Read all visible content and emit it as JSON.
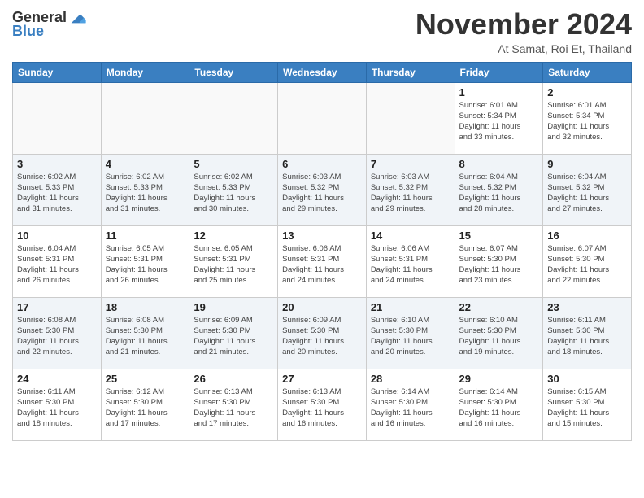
{
  "logo": {
    "general": "General",
    "blue": "Blue"
  },
  "title": "November 2024",
  "subtitle": "At Samat, Roi Et, Thailand",
  "days_of_week": [
    "Sunday",
    "Monday",
    "Tuesday",
    "Wednesday",
    "Thursday",
    "Friday",
    "Saturday"
  ],
  "weeks": [
    [
      {
        "day": "",
        "info": "",
        "empty": true
      },
      {
        "day": "",
        "info": "",
        "empty": true
      },
      {
        "day": "",
        "info": "",
        "empty": true
      },
      {
        "day": "",
        "info": "",
        "empty": true
      },
      {
        "day": "",
        "info": "",
        "empty": true
      },
      {
        "day": "1",
        "info": "Sunrise: 6:01 AM\nSunset: 5:34 PM\nDaylight: 11 hours\nand 33 minutes."
      },
      {
        "day": "2",
        "info": "Sunrise: 6:01 AM\nSunset: 5:34 PM\nDaylight: 11 hours\nand 32 minutes."
      }
    ],
    [
      {
        "day": "3",
        "info": "Sunrise: 6:02 AM\nSunset: 5:33 PM\nDaylight: 11 hours\nand 31 minutes."
      },
      {
        "day": "4",
        "info": "Sunrise: 6:02 AM\nSunset: 5:33 PM\nDaylight: 11 hours\nand 31 minutes."
      },
      {
        "day": "5",
        "info": "Sunrise: 6:02 AM\nSunset: 5:33 PM\nDaylight: 11 hours\nand 30 minutes."
      },
      {
        "day": "6",
        "info": "Sunrise: 6:03 AM\nSunset: 5:32 PM\nDaylight: 11 hours\nand 29 minutes."
      },
      {
        "day": "7",
        "info": "Sunrise: 6:03 AM\nSunset: 5:32 PM\nDaylight: 11 hours\nand 29 minutes."
      },
      {
        "day": "8",
        "info": "Sunrise: 6:04 AM\nSunset: 5:32 PM\nDaylight: 11 hours\nand 28 minutes."
      },
      {
        "day": "9",
        "info": "Sunrise: 6:04 AM\nSunset: 5:32 PM\nDaylight: 11 hours\nand 27 minutes."
      }
    ],
    [
      {
        "day": "10",
        "info": "Sunrise: 6:04 AM\nSunset: 5:31 PM\nDaylight: 11 hours\nand 26 minutes."
      },
      {
        "day": "11",
        "info": "Sunrise: 6:05 AM\nSunset: 5:31 PM\nDaylight: 11 hours\nand 26 minutes."
      },
      {
        "day": "12",
        "info": "Sunrise: 6:05 AM\nSunset: 5:31 PM\nDaylight: 11 hours\nand 25 minutes."
      },
      {
        "day": "13",
        "info": "Sunrise: 6:06 AM\nSunset: 5:31 PM\nDaylight: 11 hours\nand 24 minutes."
      },
      {
        "day": "14",
        "info": "Sunrise: 6:06 AM\nSunset: 5:31 PM\nDaylight: 11 hours\nand 24 minutes."
      },
      {
        "day": "15",
        "info": "Sunrise: 6:07 AM\nSunset: 5:30 PM\nDaylight: 11 hours\nand 23 minutes."
      },
      {
        "day": "16",
        "info": "Sunrise: 6:07 AM\nSunset: 5:30 PM\nDaylight: 11 hours\nand 22 minutes."
      }
    ],
    [
      {
        "day": "17",
        "info": "Sunrise: 6:08 AM\nSunset: 5:30 PM\nDaylight: 11 hours\nand 22 minutes."
      },
      {
        "day": "18",
        "info": "Sunrise: 6:08 AM\nSunset: 5:30 PM\nDaylight: 11 hours\nand 21 minutes."
      },
      {
        "day": "19",
        "info": "Sunrise: 6:09 AM\nSunset: 5:30 PM\nDaylight: 11 hours\nand 21 minutes."
      },
      {
        "day": "20",
        "info": "Sunrise: 6:09 AM\nSunset: 5:30 PM\nDaylight: 11 hours\nand 20 minutes."
      },
      {
        "day": "21",
        "info": "Sunrise: 6:10 AM\nSunset: 5:30 PM\nDaylight: 11 hours\nand 20 minutes."
      },
      {
        "day": "22",
        "info": "Sunrise: 6:10 AM\nSunset: 5:30 PM\nDaylight: 11 hours\nand 19 minutes."
      },
      {
        "day": "23",
        "info": "Sunrise: 6:11 AM\nSunset: 5:30 PM\nDaylight: 11 hours\nand 18 minutes."
      }
    ],
    [
      {
        "day": "24",
        "info": "Sunrise: 6:11 AM\nSunset: 5:30 PM\nDaylight: 11 hours\nand 18 minutes."
      },
      {
        "day": "25",
        "info": "Sunrise: 6:12 AM\nSunset: 5:30 PM\nDaylight: 11 hours\nand 17 minutes."
      },
      {
        "day": "26",
        "info": "Sunrise: 6:13 AM\nSunset: 5:30 PM\nDaylight: 11 hours\nand 17 minutes."
      },
      {
        "day": "27",
        "info": "Sunrise: 6:13 AM\nSunset: 5:30 PM\nDaylight: 11 hours\nand 16 minutes."
      },
      {
        "day": "28",
        "info": "Sunrise: 6:14 AM\nSunset: 5:30 PM\nDaylight: 11 hours\nand 16 minutes."
      },
      {
        "day": "29",
        "info": "Sunrise: 6:14 AM\nSunset: 5:30 PM\nDaylight: 11 hours\nand 16 minutes."
      },
      {
        "day": "30",
        "info": "Sunrise: 6:15 AM\nSunset: 5:30 PM\nDaylight: 11 hours\nand 15 minutes."
      }
    ]
  ]
}
